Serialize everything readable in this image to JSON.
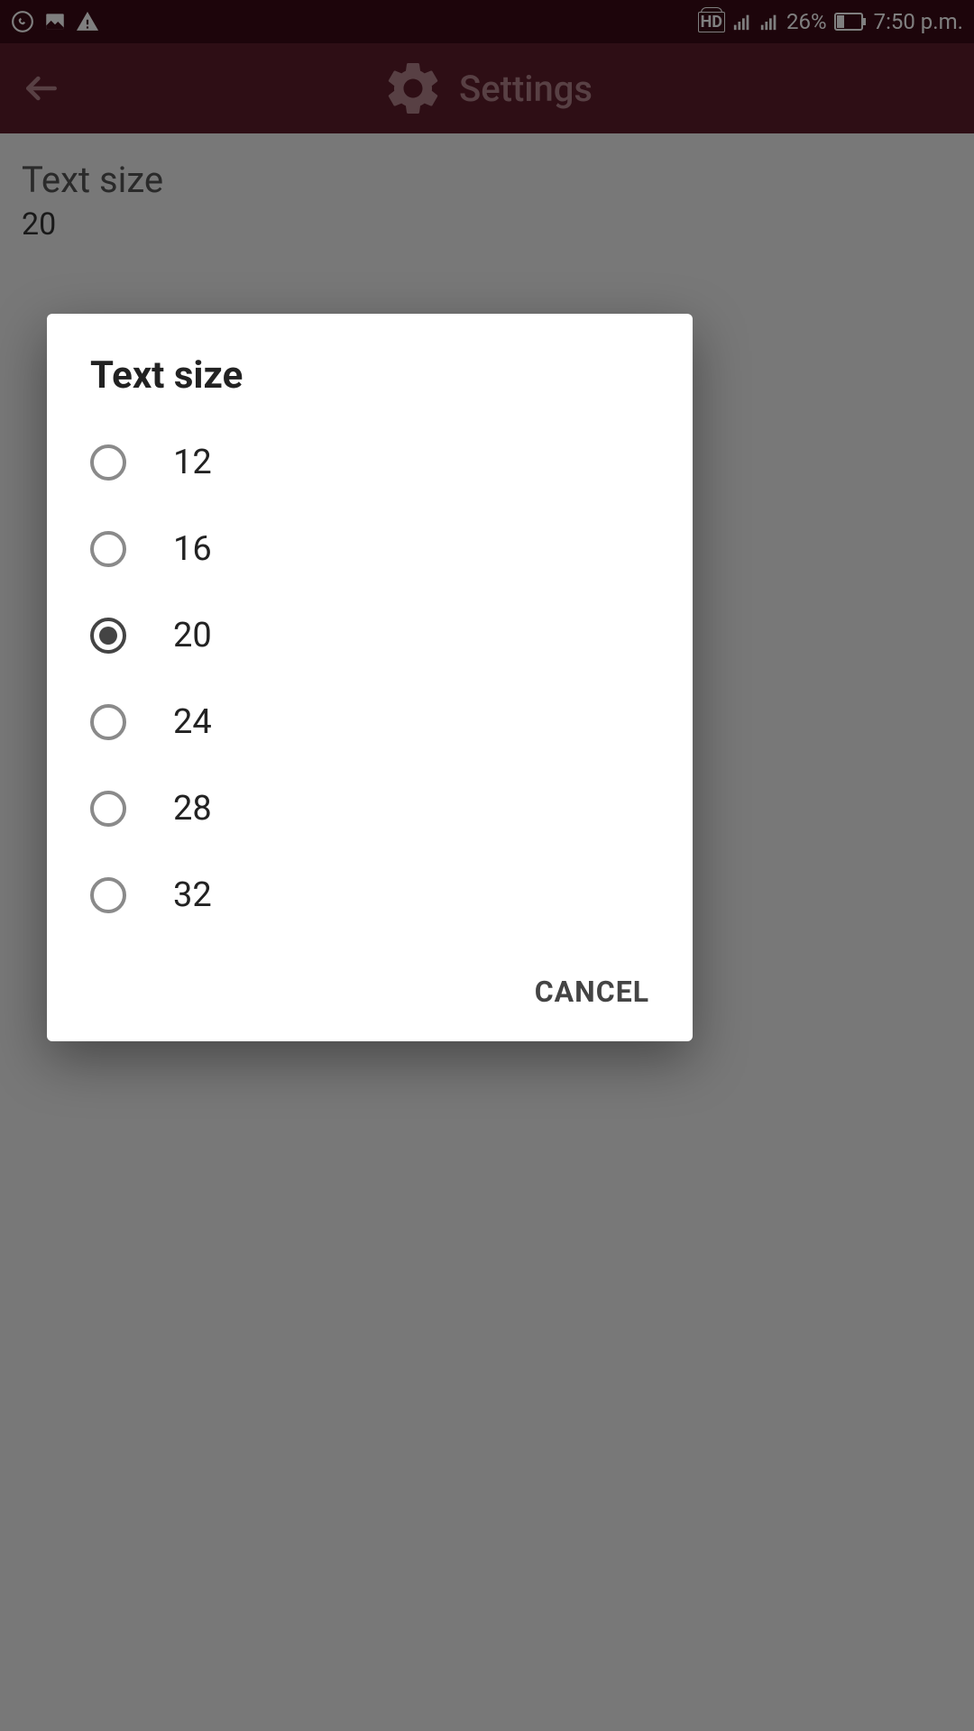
{
  "status_bar": {
    "battery_percent": "26%",
    "time": "7:50 p.m."
  },
  "app_bar": {
    "title": "Settings"
  },
  "content": {
    "setting_title": "Text size",
    "setting_value": "20"
  },
  "dialog": {
    "title": "Text size",
    "options": [
      "12",
      "16",
      "20",
      "24",
      "28",
      "32"
    ],
    "selected_index": 2,
    "cancel_label": "CANCEL"
  }
}
